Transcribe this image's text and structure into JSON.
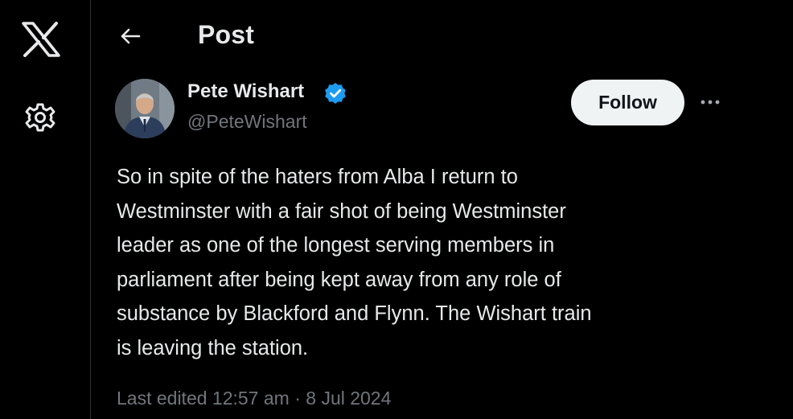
{
  "app": {
    "logo_icon": "x-logo-icon",
    "settings_icon": "gear-icon"
  },
  "header": {
    "back_icon": "back-arrow-icon",
    "title": "Post"
  },
  "post": {
    "author": {
      "name": "Pete Wishart",
      "handle": "@PeteWishart",
      "verified": true,
      "verified_icon": "verified-badge-icon",
      "avatar_icon": "avatar-photo"
    },
    "follow_label": "Follow",
    "more_icon": "more-options-icon",
    "text": "So in spite of the haters from Alba I return to\nWestminster with a fair shot of being Westminster\nleader as one of the longest serving members in\nparliament after being kept away from any role of\nsubstance by Blackford and Flynn. The Wishart train\nis leaving the station.",
    "meta": "Last edited 12:57 am · 8 Jul 2024"
  },
  "colors": {
    "background": "#000000",
    "text_primary": "#e7e9ea",
    "text_secondary": "#71767b",
    "divider": "#2f3336",
    "follow_bg": "#eff3f4",
    "verified": "#1d9bf0"
  }
}
